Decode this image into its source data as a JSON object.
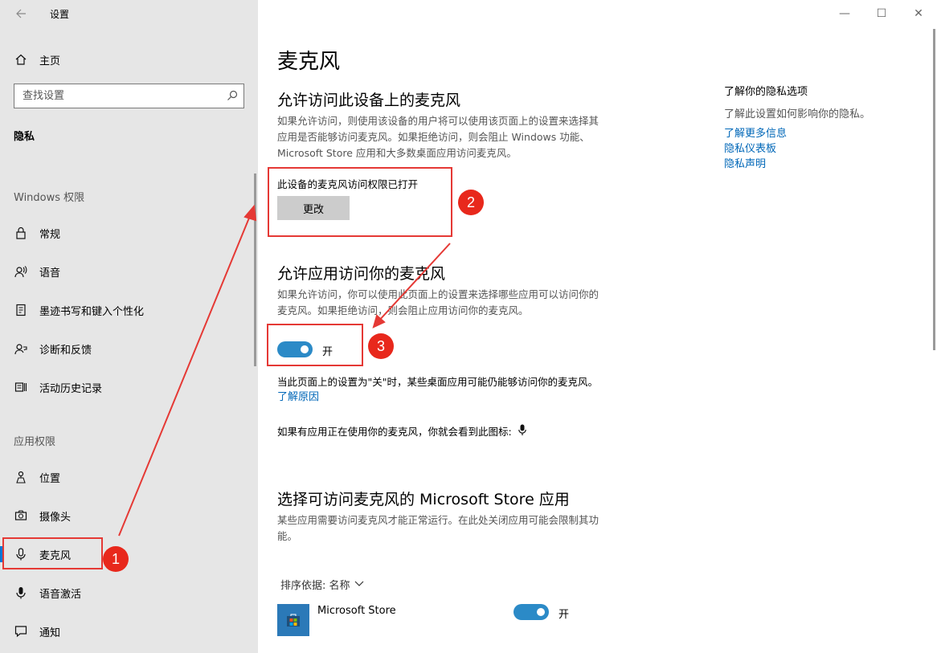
{
  "window": {
    "app_title": "设置",
    "minimize": "—",
    "maximize": "☐",
    "close": "✕"
  },
  "sidebar": {
    "home_label": "主页",
    "search_placeholder": "查找设置",
    "section_title": "隐私",
    "group_windows": "Windows 权限",
    "windows_items": [
      {
        "label": "常规",
        "icon": "lock-icon"
      },
      {
        "label": "语音",
        "icon": "speech-icon"
      },
      {
        "label": "墨迹书写和键入个性化",
        "icon": "inking-icon"
      },
      {
        "label": "诊断和反馈",
        "icon": "feedback-icon"
      },
      {
        "label": "活动历史记录",
        "icon": "history-icon"
      }
    ],
    "group_apps": "应用权限",
    "app_items": [
      {
        "label": "位置",
        "icon": "location-icon"
      },
      {
        "label": "摄像头",
        "icon": "camera-icon"
      },
      {
        "label": "麦克风",
        "icon": "microphone-icon",
        "selected": true
      },
      {
        "label": "语音激活",
        "icon": "voice-activation-icon"
      },
      {
        "label": "通知",
        "icon": "notification-icon"
      }
    ]
  },
  "main": {
    "page_title": "麦克风",
    "device_section": {
      "heading": "允许访问此设备上的麦克风",
      "desc_1": "如果允许访问，则使用该设备的用户将可以使用该页面上的设置来选择其",
      "desc_2": "应用是否能够访问麦克风。如果拒绝访问，则会阻止 Windows 功能、",
      "desc_3": "Microsoft Store 应用和大多数桌面应用访问麦克风。",
      "status": "此设备的麦克风访问权限已打开",
      "change_button": "更改"
    },
    "app_section": {
      "heading": "允许应用访问你的麦克风",
      "desc_1": "如果允许访问，你可以使用此页面上的设置来选择哪些应用可以访问你的",
      "desc_2": "麦克风。如果拒绝访问，则会阻止应用访问你的麦克风。",
      "toggle_label": "开",
      "note": "当此页面上的设置为\"关\"时，某些桌面应用可能仍能够访问你的麦克风。",
      "learn_why": "了解原因",
      "icon_note": "如果有应用正在使用你的麦克风，你就会看到此图标:"
    },
    "store_section": {
      "heading": "选择可访问麦克风的 Microsoft Store 应用",
      "desc_1": "某些应用需要访问麦克风才能正常运行。在此处关闭应用可能会限制其功",
      "desc_2": "能。",
      "sort_label": "排序依据: 名称",
      "apps": [
        {
          "name": "Microsoft Store",
          "toggle_label": "开"
        }
      ]
    },
    "related": {
      "title": "了解你的隐私选项",
      "desc": "了解此设置如何影响你的隐私。",
      "links": [
        "了解更多信息",
        "隐私仪表板",
        "隐私声明"
      ]
    }
  },
  "annotations": {
    "badge_1": "1",
    "badge_2": "2",
    "badge_3": "3",
    "color": "#e53935"
  }
}
